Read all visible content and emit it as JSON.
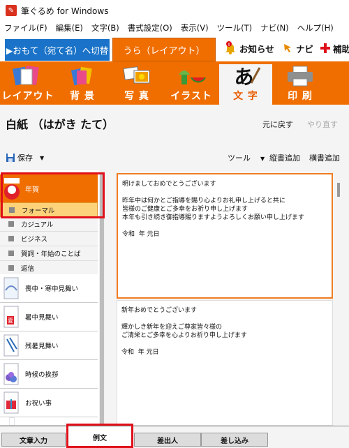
{
  "window": {
    "title": "筆ぐるめ for Windows"
  },
  "menu": [
    "ファイル(F)",
    "編集(E)",
    "文字(B)",
    "書式設定(O)",
    "表示(V)",
    "ツール(T)",
    "ナビ(N)",
    "ヘルプ(H)"
  ],
  "mode_tabs": {
    "omote": "▶おもて（宛て名）へ切替",
    "ura": "うら（レイアウト）"
  },
  "top_links": {
    "notice": "お知らせ",
    "navi": "ナビ",
    "hojo": "補助"
  },
  "ribbon": [
    {
      "label": "レイアウト",
      "icon": "layout-icon"
    },
    {
      "label": "背 景",
      "icon": "background-icon"
    },
    {
      "label": "写 真",
      "icon": "photo-icon"
    },
    {
      "label": "イラスト",
      "icon": "illust-icon"
    },
    {
      "label": "文 字",
      "icon": "text-icon",
      "active": true
    },
    {
      "label": "印 刷",
      "icon": "printer-icon"
    }
  ],
  "page": {
    "title": "白紙 （はがき たて）",
    "undo": "元に戻す",
    "redo": "やり直す"
  },
  "toolbar": {
    "save": "保存",
    "tools": "ツール",
    "tategaki": "縦書追加",
    "yokogaki": "横書追加"
  },
  "categories": [
    {
      "label": "年賀",
      "selected": true
    },
    {
      "label": "喪中・寒中見舞い"
    },
    {
      "label": "暑中見舞い"
    },
    {
      "label": "残暑見舞い"
    },
    {
      "label": "時候の挨拶"
    },
    {
      "label": "お祝い事"
    }
  ],
  "subitems": [
    {
      "label": "フォーマル",
      "selected": true
    },
    {
      "label": "カジュアル"
    },
    {
      "label": "ビジネス"
    },
    {
      "label": "賀詞・年始のことば"
    },
    {
      "label": "返信"
    }
  ],
  "cards": [
    {
      "lines": [
        "明けましておめでとうございます",
        "",
        "昨年中は何かとご指導を賜り心よりお礼申し上げると共に",
        "皆様のご健康とご多幸をお祈り申し上げます",
        "本年も引き続き御指導賜りますようよろしくお願い申し上げます",
        "",
        "令和  年 元日"
      ]
    },
    {
      "lines": [
        "新年おめでとうございます",
        "",
        "輝かしき新年を迎えご尊家皆々様の",
        "ご清栄とご多幸を心よりお祈り申し上げます",
        "",
        "令和  年 元日"
      ]
    }
  ],
  "bottom_tabs": [
    "文章入力",
    "例文",
    "差出人",
    "差し込み"
  ],
  "colors": {
    "accent": "#f06e00",
    "blue": "#1a73c8",
    "highlight": "#e0101a"
  }
}
